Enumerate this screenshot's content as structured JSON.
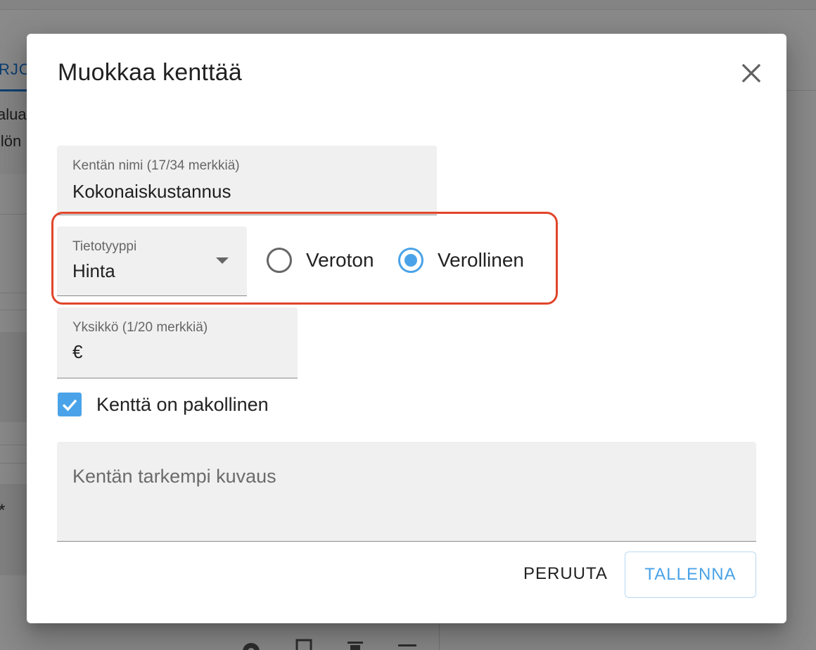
{
  "background": {
    "tab_label": "RJO",
    "intro_lines": [
      "aluat",
      "ilön"
    ],
    "required_star": "*"
  },
  "dialog": {
    "title": "Muokkaa kenttää",
    "close_icon": "close-icon",
    "name_field": {
      "label": "Kentän nimi (17/34 merkkiä)",
      "value": "Kokonaiskustannus"
    },
    "type_field": {
      "label": "Tietotyyppi",
      "value": "Hinta"
    },
    "tax_options": [
      {
        "label": "Veroton",
        "checked": false
      },
      {
        "label": "Verollinen",
        "checked": true
      }
    ],
    "unit_field": {
      "label": "Yksikkö (1/20 merkkiä)",
      "value": "€"
    },
    "required_checkbox": {
      "label": "Kenttä on pakollinen",
      "checked": true
    },
    "description": {
      "placeholder": "Kentän tarkempi kuvaus"
    },
    "cancel_label": "PERUUTA",
    "save_label": "TALLENNA"
  },
  "colors": {
    "accent": "#4aa3e8",
    "highlight": "#e0452b",
    "primary_tab": "#1976d2"
  }
}
